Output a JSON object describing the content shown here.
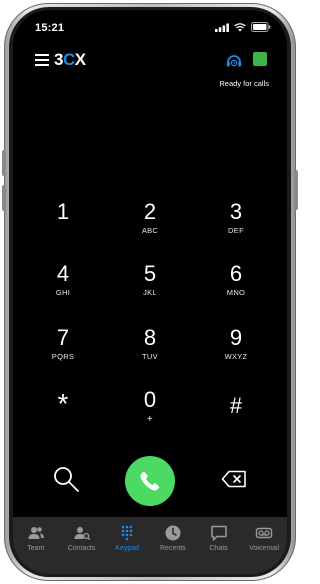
{
  "status_bar": {
    "time": "15:21"
  },
  "header": {
    "logo_part1": "3",
    "logo_part2": "C",
    "logo_part3": "X",
    "status_text": "Ready for calls",
    "status_color": "#3cb44a",
    "presence_icon": "headset-clock-icon"
  },
  "keypad": [
    {
      "digit": "1",
      "letters": ""
    },
    {
      "digit": "2",
      "letters": "ABC"
    },
    {
      "digit": "3",
      "letters": "DEF"
    },
    {
      "digit": "4",
      "letters": "GHI"
    },
    {
      "digit": "5",
      "letters": "JKL"
    },
    {
      "digit": "6",
      "letters": "MNO"
    },
    {
      "digit": "7",
      "letters": "PQRS"
    },
    {
      "digit": "8",
      "letters": "TUV"
    },
    {
      "digit": "9",
      "letters": "WXYZ"
    },
    {
      "digit": "*",
      "letters": ""
    },
    {
      "digit": "0",
      "letters": "+"
    },
    {
      "digit": "#",
      "letters": ""
    }
  ],
  "actions": {
    "search_icon": "search-icon",
    "call_icon": "phone-icon",
    "call_color": "#4cd964",
    "backspace_icon": "backspace-icon"
  },
  "tabs": [
    {
      "label": "Team",
      "icon": "team-icon",
      "active": false
    },
    {
      "label": "Contacts",
      "icon": "contacts-icon",
      "active": false
    },
    {
      "label": "Keypad",
      "icon": "keypad-icon",
      "active": true
    },
    {
      "label": "Recents",
      "icon": "clock-icon",
      "active": false
    },
    {
      "label": "Chats",
      "icon": "chat-icon",
      "active": false
    },
    {
      "label": "Voicemail",
      "icon": "voicemail-icon",
      "active": false
    }
  ],
  "colors": {
    "accent": "#1e88e5",
    "background": "#000000"
  }
}
